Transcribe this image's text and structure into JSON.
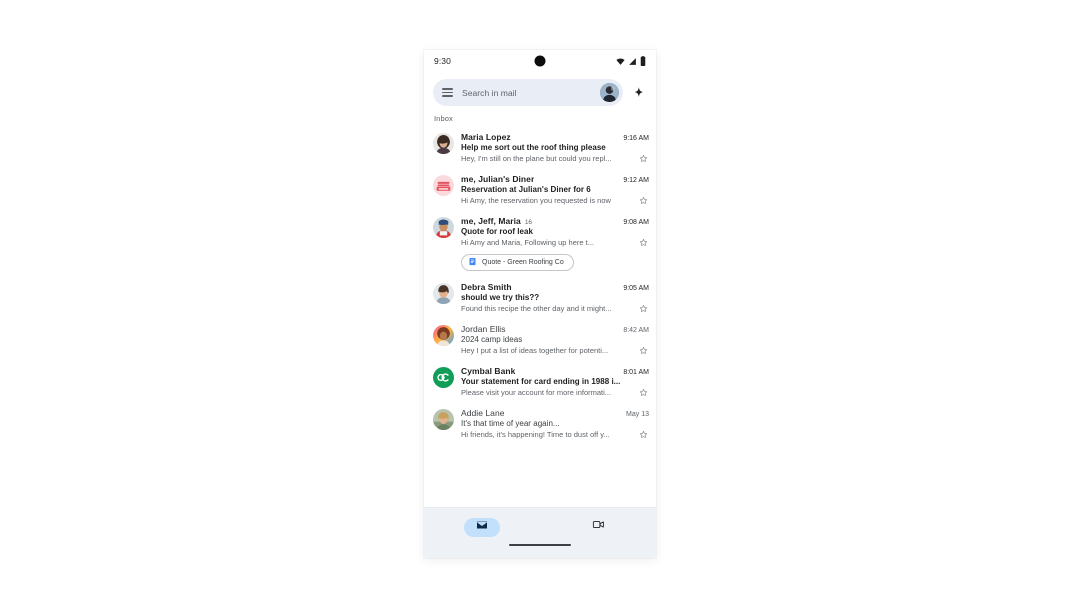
{
  "status_bar": {
    "time": "9:30",
    "icons": [
      "wifi-icon",
      "signal-icon",
      "battery-icon"
    ]
  },
  "search": {
    "menu_icon": "hamburger-menu-icon",
    "placeholder": "Search in mail",
    "avatar": "account-avatar",
    "assistant_icon": "gemini-sparkle-icon"
  },
  "inbox": {
    "label": "Inbox"
  },
  "emails": [
    {
      "sender": "Maria Lopez",
      "count": "",
      "subject": "Help me sort out the roof thing please",
      "snippet": "Hey, I'm still on the plane but could you repl...",
      "time": "9:16 AM",
      "unread": true,
      "avatar_kind": "photo-woman-dark-hair",
      "attachment": null
    },
    {
      "sender": "me, Julian's Diner",
      "count": "",
      "subject": "Reservation at Julian's Diner for 6",
      "snippet": "Hi Amy, the reservation you requested is now",
      "time": "9:12 AM",
      "unread": true,
      "avatar_kind": "logo-diner-pink",
      "attachment": null
    },
    {
      "sender": "me, Jeff, Maria",
      "count": "16",
      "subject": "Quote for roof leak",
      "snippet": "Hi Amy and Maria, Following up here t...",
      "time": "9:08 AM",
      "unread": true,
      "avatar_kind": "photo-person-red-shirt",
      "attachment": {
        "icon": "google-docs-icon",
        "label": "Quote - Green Roofing Co"
      }
    },
    {
      "sender": "Debra Smith",
      "count": "",
      "subject": "should we try this??",
      "snippet": "Found this recipe the other day and it might...",
      "time": "9:05 AM",
      "unread": true,
      "avatar_kind": "photo-woman-smiling",
      "attachment": null
    },
    {
      "sender": "Jordan Ellis",
      "count": "",
      "subject": "2024 camp ideas",
      "snippet": "Hey I put a list of ideas together for potenti...",
      "time": "8:42 AM",
      "unread": false,
      "avatar_kind": "photo-woman-curly-colorful",
      "attachment": null
    },
    {
      "sender": "Cymbal Bank",
      "count": "",
      "subject": "Your statement for card ending in 1988 i...",
      "snippet": "Please visit your account for more informati...",
      "time": "8:01 AM",
      "unread": true,
      "avatar_kind": "logo-cymbal-green",
      "attachment": null
    },
    {
      "sender": "Addie Lane",
      "count": "",
      "subject": "It's that time of year again...",
      "snippet": "Hi friends, it's happening! Time to dust off y...",
      "time": "May 13",
      "unread": false,
      "avatar_kind": "photo-woman-outdoors",
      "attachment": null
    }
  ],
  "bottom_nav": [
    {
      "icon": "mail-icon",
      "active": true
    },
    {
      "icon": "meet-video-icon",
      "active": false
    }
  ],
  "colors": {
    "search_bg": "#e9eef6",
    "nav_bg": "#eef1f6",
    "nav_active_pill": "#c2e0fb",
    "text_primary": "#1f1f1f",
    "text_secondary": "#5f6368",
    "chip_border": "#c4c7c5",
    "docs_blue": "#4285f4",
    "cymbal_green": "#0f9d58"
  }
}
